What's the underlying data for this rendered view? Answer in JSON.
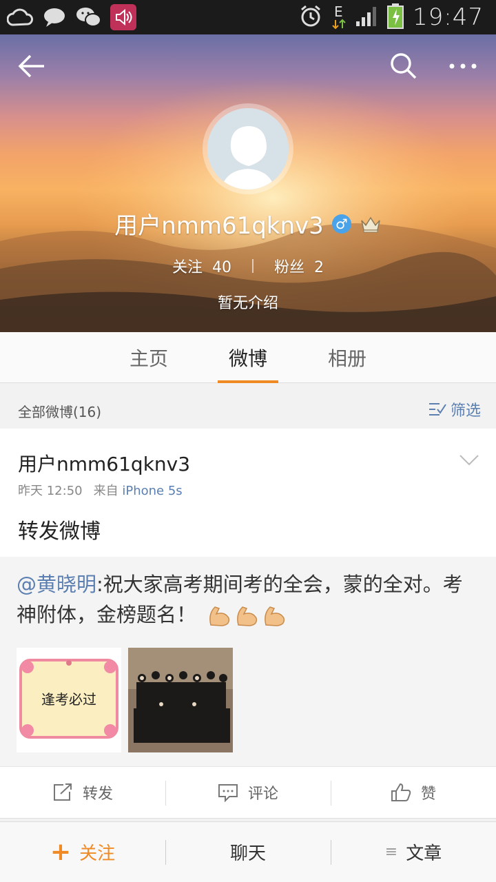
{
  "status_bar": {
    "time": "19:47",
    "network": "E",
    "icons": [
      "cloud-icon",
      "chat-bubble-icon",
      "wechat-icon",
      "volume-icon",
      "alarm-icon",
      "signal-icon",
      "battery-icon"
    ]
  },
  "header": {
    "username": "用户nmm61qknv3",
    "gender_symbol": "♂",
    "follow_label": "关注",
    "follow_count": "40",
    "fans_label": "粉丝",
    "fans_count": "2",
    "bio": "暂无介绍"
  },
  "tabs": [
    {
      "label": "主页",
      "active": false
    },
    {
      "label": "微博",
      "active": true
    },
    {
      "label": "相册",
      "active": false
    }
  ],
  "filter": {
    "count_text": "全部微博(16)",
    "filter_label": "筛选"
  },
  "post": {
    "author": "用户nmm61qknv3",
    "time": "昨天 12:50",
    "source_prefix": "来自",
    "source": "iPhone 5s",
    "text": "转发微博",
    "repost": {
      "mention": "@黄晓明",
      "text": ":祝大家高考期间考的全会，蒙的全对。考神附体，金榜题名！",
      "image1_caption": "逢考必过"
    },
    "actions": {
      "repost": "转发",
      "comment": "评论",
      "like": "赞"
    }
  },
  "bottom_bar": {
    "follow": "关注",
    "chat": "聊天",
    "article": "文章"
  },
  "colors": {
    "accent": "#f08a24",
    "link": "#5b7fb0"
  }
}
